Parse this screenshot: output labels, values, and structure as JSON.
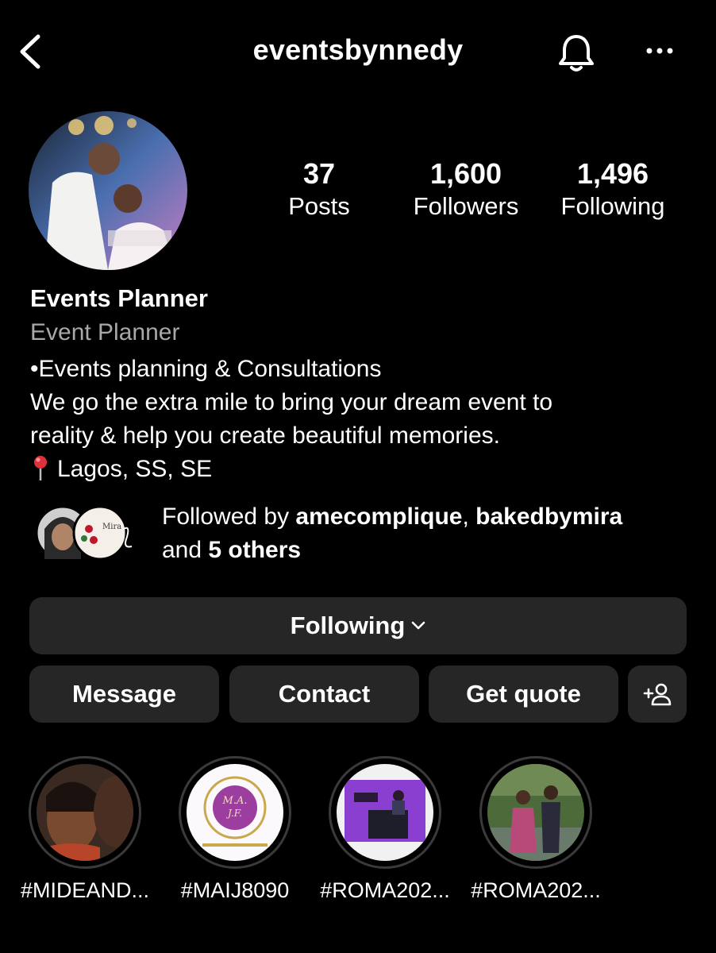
{
  "header": {
    "username": "eventsbynnedy"
  },
  "stats": {
    "posts_count": "37",
    "posts_label": "Posts",
    "followers_count": "1,600",
    "followers_label": "Followers",
    "following_count": "1,496",
    "following_label": "Following"
  },
  "bio": {
    "name": "Events Planner",
    "category": "Event Planner",
    "line1": "•Events planning & Consultations",
    "line2": "We go the extra mile to bring your dream event to",
    "line3": "reality & help you create beautiful memories.",
    "location": "Lagos, SS, SE"
  },
  "followed_by": {
    "prefix": "Followed by ",
    "user1": "amecomplique",
    "separator": ", ",
    "user2": "bakedbymira",
    "and_text": "and ",
    "others": "5 others"
  },
  "buttons": {
    "following": "Following",
    "message": "Message",
    "contact": "Contact",
    "get_quote": "Get quote"
  },
  "highlights": [
    {
      "label": "#MIDEAND..."
    },
    {
      "label": "#MAIJ8090"
    },
    {
      "label": "#ROMA202..."
    },
    {
      "label": "#ROMA202..."
    }
  ],
  "icons": {
    "back": "chevron-left-icon",
    "notifications": "bell-icon",
    "more": "more-horizontal-icon",
    "location": "pin-icon",
    "add_person": "add-person-icon"
  },
  "colors": {
    "background": "#000000",
    "button_bg": "#262626",
    "secondary_text": "#a8a8a8",
    "pin_red": "#e0313a"
  }
}
